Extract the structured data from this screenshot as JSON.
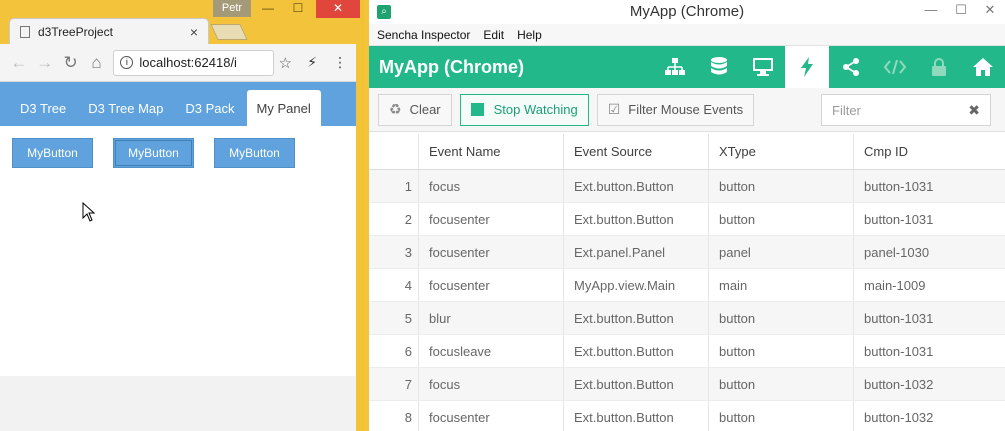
{
  "browser": {
    "user": "Petr",
    "tab_title": "d3TreeProject",
    "tab_close": "×",
    "address": "localhost:62418/i",
    "info_glyph": "i",
    "back_glyph": "←",
    "forward_glyph": "→",
    "reload_glyph": "↻",
    "home_glyph": "⌂",
    "star_glyph": "☆",
    "ext_glyph": "⚡",
    "menu_glyph": "⋮",
    "win_min": "—",
    "win_max": "☐",
    "win_close": "✕"
  },
  "app": {
    "tabs": [
      {
        "label": "D3 Tree"
      },
      {
        "label": "D3 Tree Map"
      },
      {
        "label": "D3 Pack"
      },
      {
        "label": "My Panel"
      }
    ],
    "active_tab": "My Panel",
    "buttons": [
      {
        "label": "MyButton"
      },
      {
        "label": "MyButton"
      },
      {
        "label": "MyButton"
      }
    ]
  },
  "inspector": {
    "window_title": "MyApp (Chrome)",
    "win_min": "—",
    "win_max": "☐",
    "win_close": "✕",
    "menu": [
      "Sencha Inspector",
      "Edit",
      "Help"
    ],
    "brand": "MyApp (Chrome)",
    "toolbar_icons": [
      "hierarchy-icon",
      "database-icon",
      "monitor-icon",
      "lightning-icon",
      "share-icon",
      "code-icon",
      "lock-icon",
      "home-icon"
    ],
    "active_icon": "lightning-icon",
    "actions": {
      "clear": "Clear",
      "stop_watching": "Stop Watching",
      "filter_mouse": "Filter Mouse Events",
      "filter_placeholder": "Filter",
      "filter_clear": "✖"
    },
    "columns": [
      "",
      "Event Name",
      "Event Source",
      "XType",
      "Cmp ID"
    ],
    "rows": [
      {
        "n": "1",
        "event": "focus",
        "source": "Ext.button.Button",
        "xtype": "button",
        "cmp": "button-1031"
      },
      {
        "n": "2",
        "event": "focusenter",
        "source": "Ext.button.Button",
        "xtype": "button",
        "cmp": "button-1031"
      },
      {
        "n": "3",
        "event": "focusenter",
        "source": "Ext.panel.Panel",
        "xtype": "panel",
        "cmp": "panel-1030"
      },
      {
        "n": "4",
        "event": "focusenter",
        "source": "MyApp.view.Main",
        "xtype": "main",
        "cmp": "main-1009"
      },
      {
        "n": "5",
        "event": "blur",
        "source": "Ext.button.Button",
        "xtype": "button",
        "cmp": "button-1031"
      },
      {
        "n": "6",
        "event": "focusleave",
        "source": "Ext.button.Button",
        "xtype": "button",
        "cmp": "button-1031"
      },
      {
        "n": "7",
        "event": "focus",
        "source": "Ext.button.Button",
        "xtype": "button",
        "cmp": "button-1032"
      },
      {
        "n": "8",
        "event": "focusenter",
        "source": "Ext.button.Button",
        "xtype": "button",
        "cmp": "button-1032"
      }
    ]
  },
  "colors": {
    "sencha_green": "#23b889",
    "ext_blue": "#5fa2dd",
    "taskbar_yellow": "#f3c43b"
  }
}
